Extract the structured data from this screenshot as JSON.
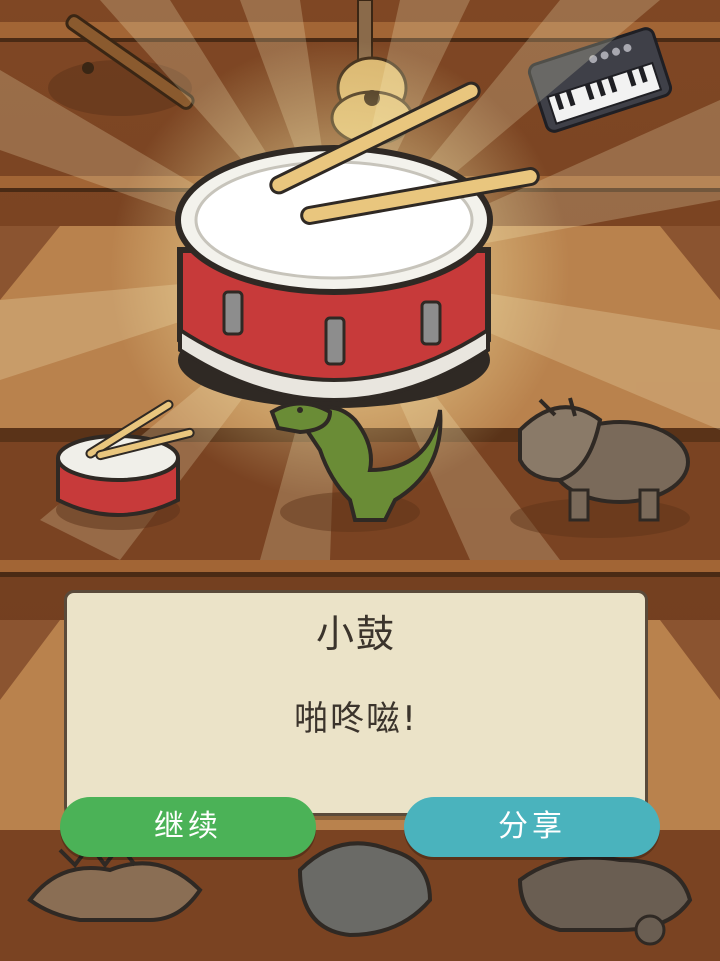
{
  "dialog": {
    "title": "小鼓",
    "sound_text": "啪咚嗞!"
  },
  "buttons": {
    "continue_label": "继续",
    "share_label": "分享"
  },
  "colors": {
    "continue_button": "#4bb257",
    "share_button": "#4ab3bd",
    "dialog_background": "#ebe3c8",
    "wood_background": "#7a4322"
  },
  "scene": {
    "featured_instrument": "snare-drum-icon",
    "shelf_items": [
      "flute-icon",
      "guitar-icon",
      "keyboard-synth-icon",
      "small-drum-icon",
      "t-rex-icon",
      "triceratops-icon",
      "stegosaurus-icon",
      "dinosaur-icon",
      "ankylosaurus-icon"
    ]
  }
}
